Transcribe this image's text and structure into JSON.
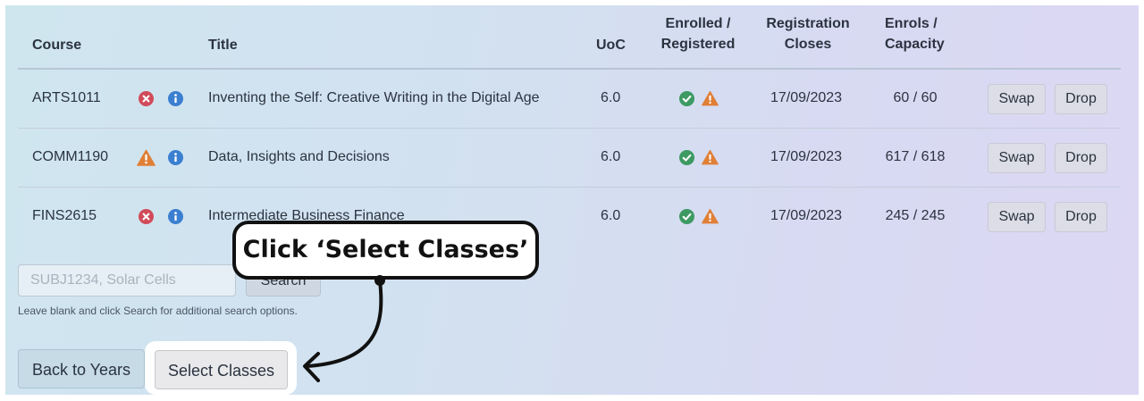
{
  "table": {
    "headers": {
      "course": "Course",
      "title": "Title",
      "uoc": "UoC",
      "enrolled_line1": "Enrolled /",
      "enrolled_line2": "Registered",
      "closes_line1": "Registration",
      "closes_line2": "Closes",
      "enrols_line1": "Enrols /",
      "enrols_line2": "Capacity"
    },
    "rows": [
      {
        "course": "ARTS1011",
        "status_icon": "error-circle-icon",
        "info_icon": "info-circle-icon",
        "title": "Inventing the Self: Creative Writing in the Digital Age",
        "uoc": "6.0",
        "enrolled_icon": "check-circle-icon",
        "registered_icon": "warning-triangle-icon",
        "closes": "17/09/2023",
        "enrols": "60 / 60",
        "swap_label": "Swap",
        "drop_label": "Drop"
      },
      {
        "course": "COMM1190",
        "status_icon": "warning-triangle-icon",
        "info_icon": "info-circle-icon",
        "title": "Data, Insights and Decisions",
        "uoc": "6.0",
        "enrolled_icon": "check-circle-icon",
        "registered_icon": "warning-triangle-icon",
        "closes": "17/09/2023",
        "enrols": "617 / 618",
        "swap_label": "Swap",
        "drop_label": "Drop"
      },
      {
        "course": "FINS2615",
        "status_icon": "error-circle-icon",
        "info_icon": "info-circle-icon",
        "title": "Intermediate Business Finance",
        "uoc": "6.0",
        "enrolled_icon": "check-circle-icon",
        "registered_icon": "warning-triangle-icon",
        "closes": "17/09/2023",
        "enrols": "245 / 245",
        "swap_label": "Swap",
        "drop_label": "Drop"
      }
    ]
  },
  "search": {
    "placeholder": "SUBJ1234, Solar Cells",
    "value": "",
    "button_label": "Search",
    "helper_text": "Leave blank and click Search for additional search options."
  },
  "actions": {
    "back_label": "Back to Years",
    "select_label": "Select Classes"
  },
  "annotation": {
    "callout_text": "Click ‘Select Classes’"
  },
  "colors": {
    "error": "#d14b5a",
    "info": "#3b7fd0",
    "success": "#3c9a62",
    "warning": "#e07f36"
  }
}
